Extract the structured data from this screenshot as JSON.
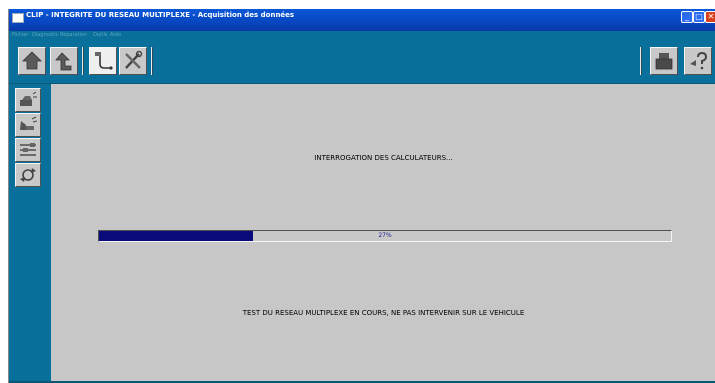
{
  "window": {
    "title": "CLIP - INTEGRITE DU RESEAU MULTIPLEXE - Acquisition des données",
    "controls": {
      "minimize": "_",
      "maximize": "□",
      "close": "✕"
    }
  },
  "menu": [
    "Fichier",
    "Diagnostic",
    "Réparation",
    "Outils",
    "Aide"
  ],
  "toolbar": {
    "left_buttons": [
      "home-icon",
      "up-arrow-icon",
      "connector-icon",
      "tools-icon"
    ],
    "right_buttons": [
      "printer-icon",
      "help-icon"
    ]
  },
  "sidebar": {
    "buttons": [
      "vehicle-front-icon",
      "vehicle-side-icon",
      "network-config-icon",
      "refresh-network-icon"
    ]
  },
  "main": {
    "status_top": "INTERROGATION DES CALCULATEURS...",
    "progress": {
      "value": 0.27,
      "label": "27%"
    },
    "status_bottom": "TEST DU RESEAU MULTIPLEXE EN COURS, NE PAS INTERVENIR SUR LE VEHICULE"
  },
  "colors": {
    "accent": "#08709a",
    "progress_fill": "#0a0a7a",
    "title_bar": "#0846c0"
  }
}
